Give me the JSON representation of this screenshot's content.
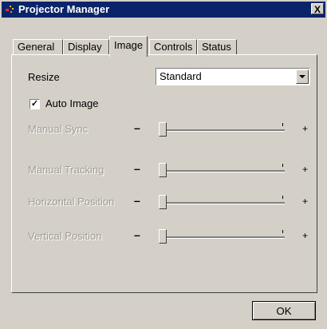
{
  "window": {
    "title": "Projector Manager",
    "close_label": "X"
  },
  "tabs": [
    {
      "label": "General",
      "active": false
    },
    {
      "label": "Display",
      "active": false
    },
    {
      "label": "Image",
      "active": true
    },
    {
      "label": "Controls",
      "active": false
    },
    {
      "label": "Status",
      "active": false
    }
  ],
  "image": {
    "resize_label": "Resize",
    "resize_value": "Standard",
    "auto_image_label": "Auto Image",
    "auto_image_checked": true,
    "sliders": [
      {
        "label": "Manual Sync",
        "value": 0.0,
        "enabled": false
      },
      {
        "label": "Manual Tracking",
        "value": 0.0,
        "enabled": false
      },
      {
        "label": "Horizontal Position",
        "value": 0.0,
        "enabled": false
      },
      {
        "label": "Vertical Position",
        "value": 0.0,
        "enabled": false
      }
    ],
    "minus_label": "–",
    "plus_label": "+"
  },
  "footer": {
    "ok_label": "OK"
  },
  "colors": {
    "titlebar": "#0a246a",
    "face": "#d4d0c8",
    "disabled_text": "#a09c94"
  },
  "icons": {
    "app": "projector-icon",
    "dropdown": "chevron-down-icon"
  }
}
